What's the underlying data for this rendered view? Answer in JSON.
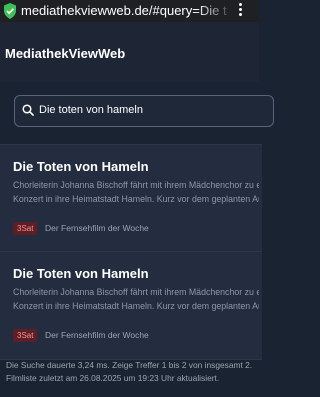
{
  "browser": {
    "url": "mediathekviewweb.de/#query=Die t"
  },
  "app": {
    "title": "MediathekViewWeb"
  },
  "search": {
    "value": "Die toten von hameln"
  },
  "results": [
    {
      "title": "Die Toten von Hameln",
      "desc_line1": "Chorleiterin Johanna Bischoff fährt mit ihrem Mädchenchor zu ei",
      "desc_line2": "Konzert in ihre Heimatstadt Hameln. Kurz vor dem geplanten Auf",
      "channel": "3Sat",
      "genre": "Der Fernsehfilm der Woche"
    },
    {
      "title": "Die Toten von Hameln",
      "desc_line1": "Chorleiterin Johanna Bischoff fährt mit ihrem Mädchenchor zu ei",
      "desc_line2": "Konzert in ihre Heimatstadt Hameln. Kurz vor dem geplanten Auf",
      "channel": "3Sat",
      "genre": "Der Fernsehfilm der Woche"
    }
  ],
  "footer": {
    "line1": "Die Suche dauerte 3,24 ms. Zeige Treffer 1 bis 2 von insgesamt 2.",
    "line2": "Filmliste zuletzt am 26.08.2025 um 19:23 Uhr aktualisiert."
  },
  "colors": {
    "background": "#1a2332",
    "card": "#232d3f",
    "badge_bg": "#5c1f27",
    "badge_text": "#ff8d8d"
  },
  "icons": [
    "shield-check-icon",
    "overflow-menu-icon",
    "search-icon"
  ]
}
